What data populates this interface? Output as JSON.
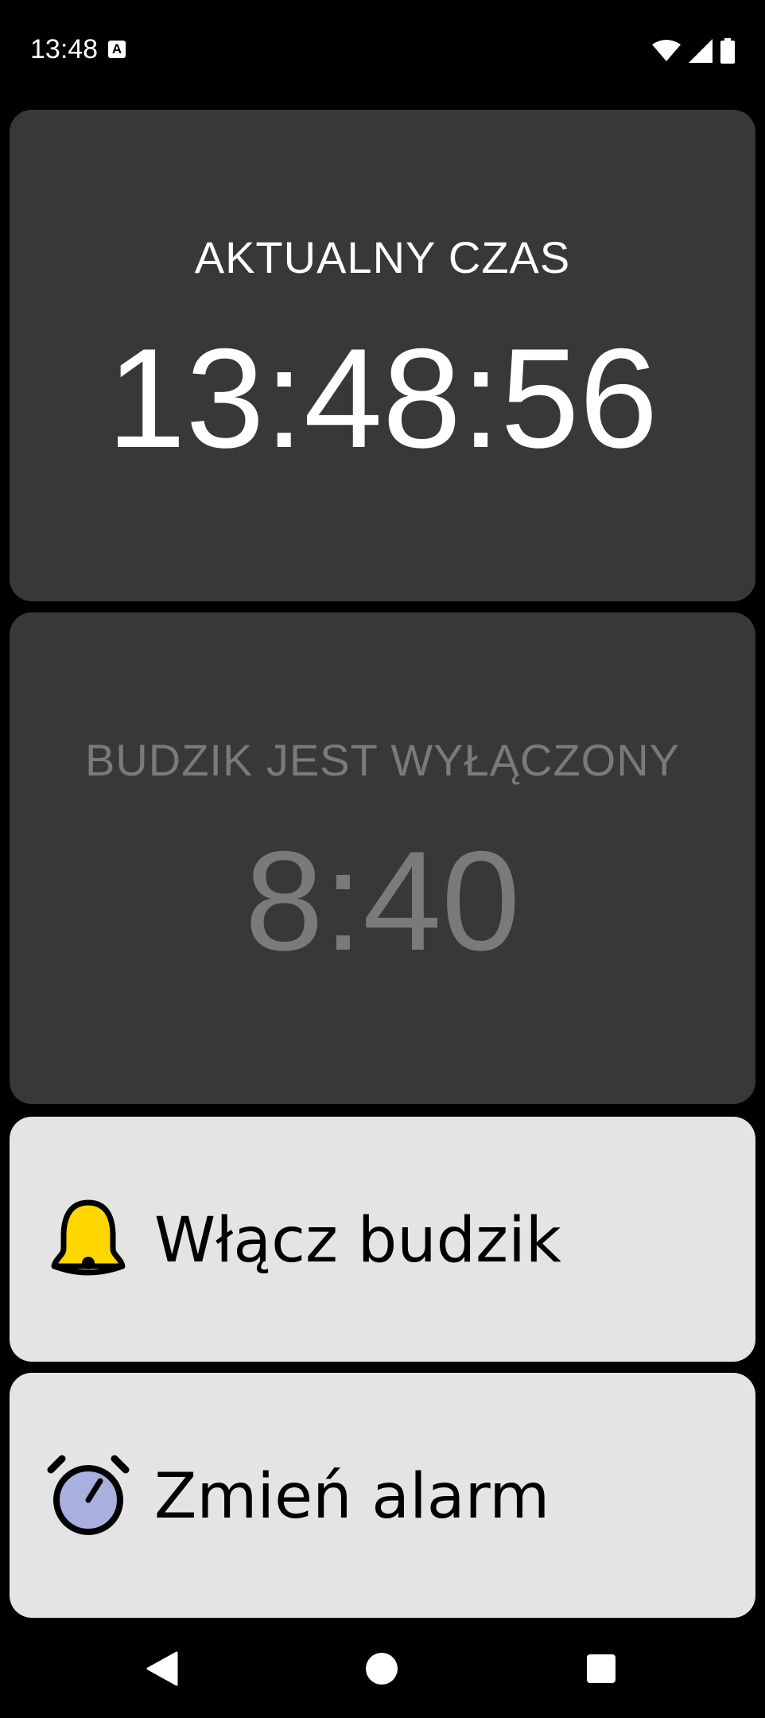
{
  "status_bar": {
    "time": "13:48",
    "notification_icon": "a-icon",
    "icons": [
      "wifi-icon",
      "signal-icon",
      "battery-icon"
    ]
  },
  "clock_card": {
    "label": "AKTUALNY CZAS",
    "time": "13:48:56"
  },
  "alarm_card": {
    "label": "BUDZIK JEST WYŁĄCZONY",
    "time": "8:40",
    "state": "off"
  },
  "buttons": {
    "enable_alarm": {
      "label": "Włącz budzik",
      "icon": "bell-icon"
    },
    "change_alarm": {
      "label": "Zmień alarm",
      "icon": "alarm-clock-icon"
    }
  },
  "nav_bar": {
    "buttons": [
      "back-icon",
      "home-icon",
      "recents-icon"
    ]
  },
  "colors": {
    "background": "#000000",
    "card_dark": "#383838",
    "card_light": "#e4e4e4",
    "text_primary": "#ffffff",
    "text_disabled": "#7a7a7a",
    "bell_yellow": "#ffd600",
    "clock_face": "#a9b0e0"
  }
}
